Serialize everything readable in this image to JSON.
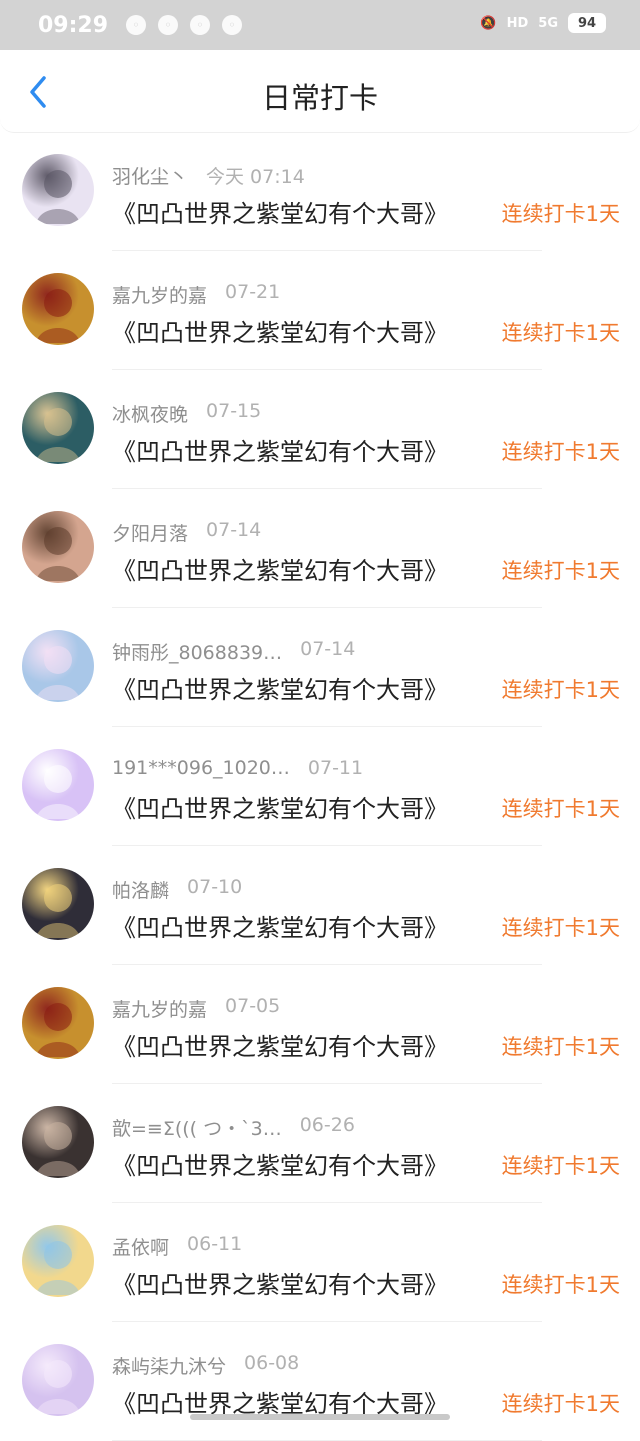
{
  "status_bar": {
    "time": "09:29",
    "left_icons": [
      "wechat-icon",
      "qq-icon",
      "clock-icon",
      "cloud-icon"
    ],
    "right_labels": {
      "hd": "HD",
      "network": "5G",
      "battery": "94"
    }
  },
  "header": {
    "title": "日常打卡"
  },
  "list": [
    {
      "name": "羽化尘丶",
      "date": "今天 07:14",
      "book": "《凹凸世界之紫堂幻有个大哥》",
      "streak": "连续打卡1天",
      "avatar": {
        "bg": "#e9e3f2",
        "fg": "#5a5564"
      }
    },
    {
      "name": "嘉九岁的嘉",
      "date": "07-21",
      "book": "《凹凸世界之紫堂幻有个大哥》",
      "streak": "连续打卡1天",
      "avatar": {
        "bg": "#c7902e",
        "fg": "#8a1d13"
      }
    },
    {
      "name": "冰枫夜晚",
      "date": "07-15",
      "book": "《凹凸世界之紫堂幻有个大哥》",
      "streak": "连续打卡1天",
      "avatar": {
        "bg": "#2c5d64",
        "fg": "#d7c08d"
      }
    },
    {
      "name": "夕阳月落",
      "date": "07-14",
      "book": "《凹凸世界之紫堂幻有个大哥》",
      "streak": "连续打卡1天",
      "avatar": {
        "bg": "#d4a58f",
        "fg": "#5d3d2b"
      }
    },
    {
      "name": "钟雨彤_8068839…",
      "date": "07-14",
      "book": "《凹凸世界之紫堂幻有个大哥》",
      "streak": "连续打卡1天",
      "avatar": {
        "bg": "#a9c7e8",
        "fg": "#f2dff4"
      }
    },
    {
      "name": "191***096_1020…",
      "date": "07-11",
      "book": "《凹凸世界之紫堂幻有个大哥》",
      "streak": "连续打卡1天",
      "avatar": {
        "bg": "#d8c2f6",
        "fg": "#ffffff"
      }
    },
    {
      "name": "帕洛麟",
      "date": "07-10",
      "book": "《凹凸世界之紫堂幻有个大哥》",
      "streak": "连续打卡1天",
      "avatar": {
        "bg": "#2f2d38",
        "fg": "#f0d17a"
      }
    },
    {
      "name": "嘉九岁的嘉",
      "date": "07-05",
      "book": "《凹凸世界之紫堂幻有个大哥》",
      "streak": "连续打卡1天",
      "avatar": {
        "bg": "#c7902e",
        "fg": "#8a1d13"
      }
    },
    {
      "name": "歆=≡Σ((( つ・`3…",
      "date": "06-26",
      "book": "《凹凸世界之紫堂幻有个大哥》",
      "streak": "连续打卡1天",
      "avatar": {
        "bg": "#3a3231",
        "fg": "#c9b2a1"
      }
    },
    {
      "name": "孟依啊",
      "date": "06-11",
      "book": "《凹凸世界之紫堂幻有个大哥》",
      "streak": "连续打卡1天",
      "avatar": {
        "bg": "#f2d88d",
        "fg": "#8ec5e8"
      }
    },
    {
      "name": "森屿柒九沐兮",
      "date": "06-08",
      "book": "《凹凸世界之紫堂幻有个大哥》",
      "streak": "连续打卡1天",
      "avatar": {
        "bg": "#d5c2ef",
        "fg": "#f4e9fb"
      }
    }
  ]
}
